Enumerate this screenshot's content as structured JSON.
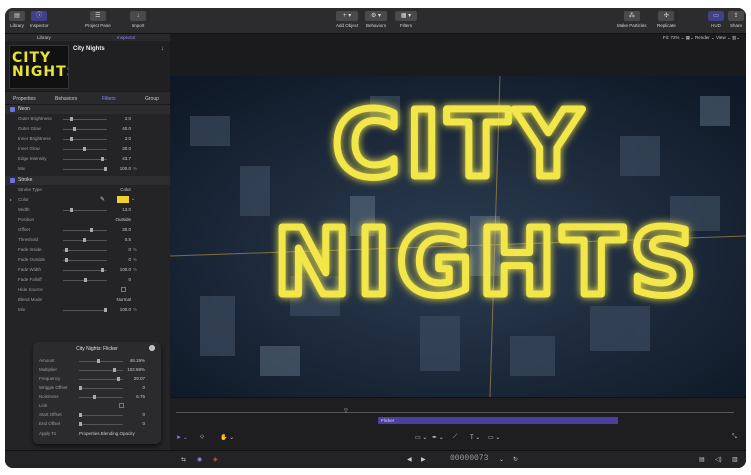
{
  "toolbar": {
    "library": "Library",
    "inspector": "Inspector",
    "project_pane": "Project Pane",
    "import": "Import",
    "add_object": "Add Object",
    "behaviors": "Behaviors",
    "filters": "Filters",
    "make_particles": "Make Particles",
    "replicate": "Replicate",
    "hud": "HUD",
    "share": "Share"
  },
  "panel_tabs": {
    "library": "Library",
    "inspector": "Inspector"
  },
  "header": {
    "title": "City Nights",
    "thumb_line1": "CITY",
    "thumb_line2": "NIGHTS"
  },
  "inspector_tabs": [
    "Properties",
    "Behaviors",
    "Filters",
    "Group"
  ],
  "neon": {
    "title": "Neon",
    "rows": [
      {
        "label": "Outer Brightness",
        "value": "2.0",
        "unit": ""
      },
      {
        "label": "Outer Glow",
        "value": "40.0",
        "unit": ""
      },
      {
        "label": "Inner Brightness",
        "value": "2.0",
        "unit": ""
      },
      {
        "label": "Inner Glow",
        "value": "30.0",
        "unit": ""
      },
      {
        "label": "Edge Intensity",
        "value": "43.7",
        "unit": ""
      },
      {
        "label": "Mix",
        "value": "100.0",
        "unit": "%"
      }
    ]
  },
  "stroke": {
    "title": "Stroke",
    "stroke_type_label": "Stroke Type",
    "stroke_type_value": "Color",
    "color_label": "Color",
    "color_hex": "#f1d02a",
    "rows": [
      {
        "label": "Width",
        "value": "13.0",
        "unit": ""
      },
      {
        "label": "Position",
        "value": "Outside",
        "unit": ""
      },
      {
        "label": "Offset",
        "value": "30.0",
        "unit": ""
      },
      {
        "label": "Threshold",
        "value": "0.5",
        "unit": ""
      },
      {
        "label": "Fade Inside",
        "value": "0",
        "unit": "%"
      },
      {
        "label": "Fade Outside",
        "value": "0",
        "unit": "%"
      },
      {
        "label": "Fade Width",
        "value": "100.0",
        "unit": "%"
      },
      {
        "label": "Fade Falloff",
        "value": "0",
        "unit": ""
      }
    ],
    "hide_source_label": "Hide Source",
    "blend_mode_label": "Blend Mode",
    "blend_mode_value": "Normal",
    "mix_label": "Mix",
    "mix_value": "100.0",
    "mix_unit": "%"
  },
  "hud": {
    "title": "City Nights: Flicker",
    "rows": [
      {
        "label": "Amount",
        "value": "48.19%"
      },
      {
        "label": "Multiplier",
        "value": "102.69%"
      },
      {
        "label": "Frequency",
        "value": "29.07"
      },
      {
        "label": "Wriggle Offset",
        "value": "0"
      },
      {
        "label": "Noisiness",
        "value": "6.75"
      },
      {
        "label": "Link",
        "value": ""
      },
      {
        "label": "Start Offset",
        "value": "0"
      },
      {
        "label": "End Offset",
        "value": "0"
      }
    ],
    "apply_to_label": "Apply To",
    "apply_to_value": "Properties.Blending.Opacity"
  },
  "viewer_bar": {
    "fit": "Fit: 72%",
    "render": "Render",
    "view": "View"
  },
  "canvas_title": {
    "line1": "CITY",
    "line2": "NIGHTS"
  },
  "timeline": {
    "bar_label": "Flicker"
  },
  "bottom": {
    "timecode": "00000073"
  },
  "colors": {
    "accent": "#6d6ee8",
    "neon": "#f2e64a",
    "timeline_bar": "#4b3fa0"
  }
}
